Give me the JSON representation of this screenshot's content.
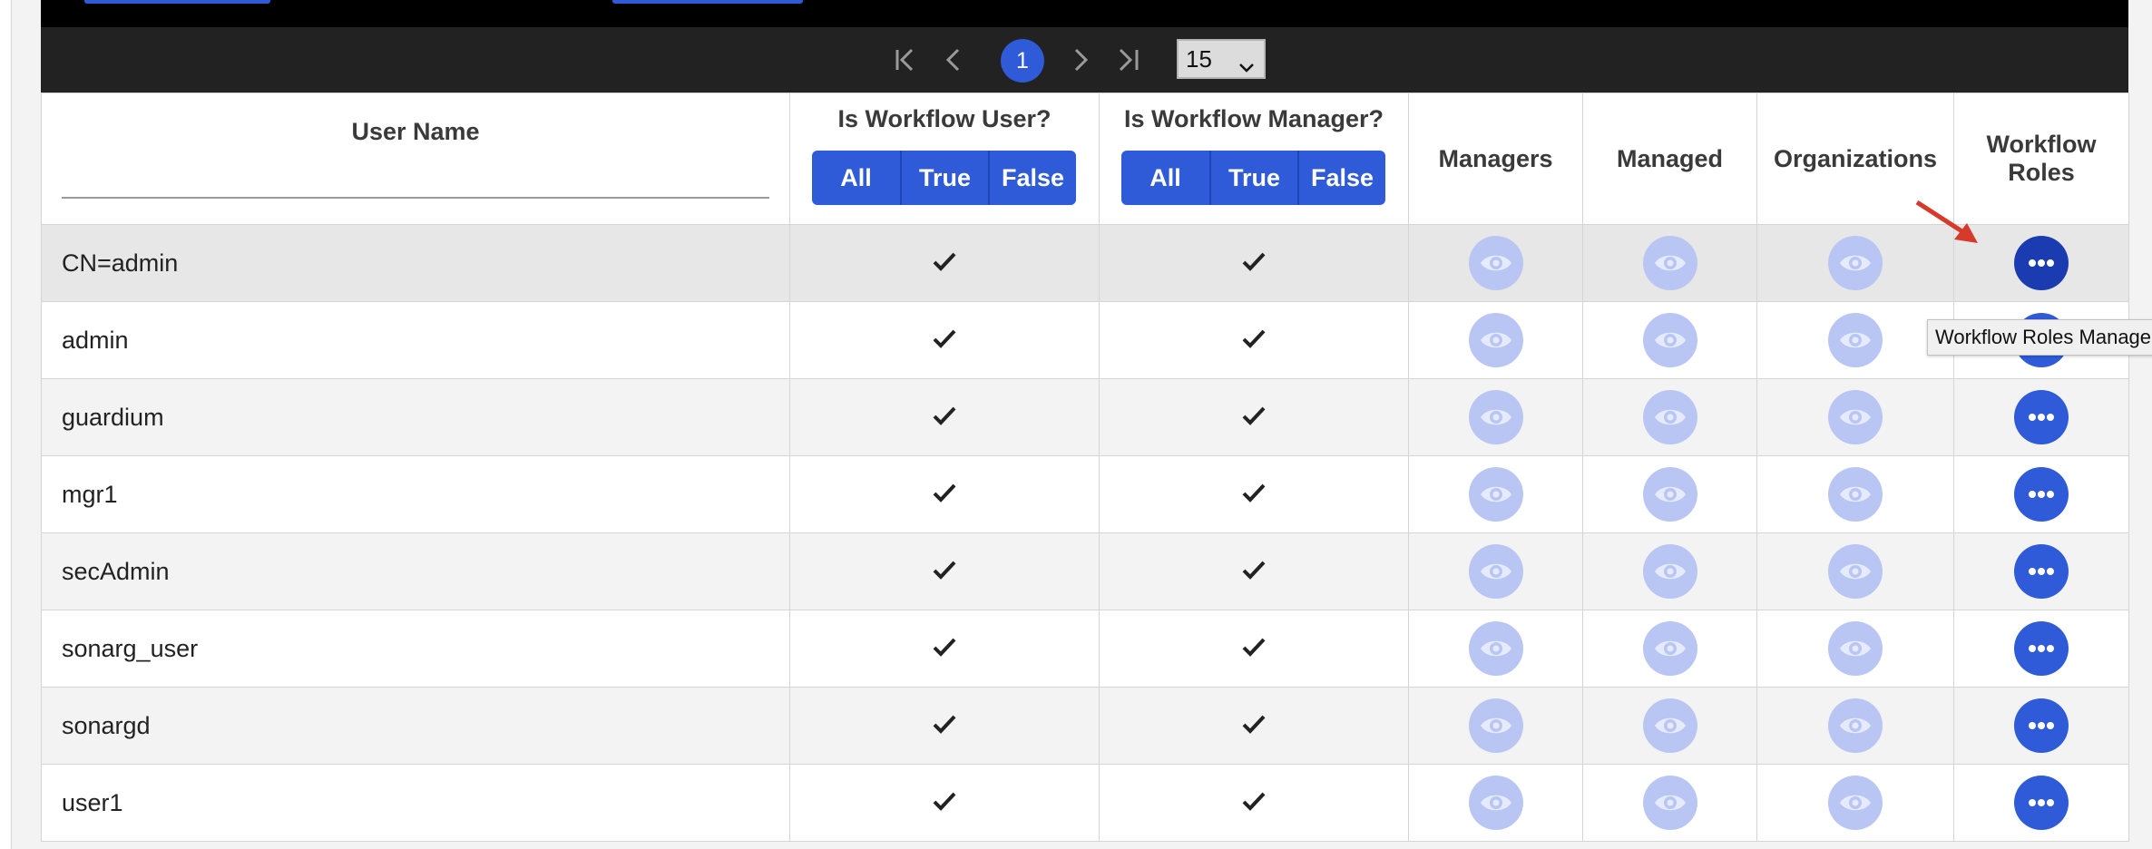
{
  "pagination": {
    "current_page": "1",
    "page_size": "15",
    "icons": [
      "first-page-icon",
      "prev-page-icon",
      "next-page-icon",
      "last-page-icon",
      "chevron-down-icon"
    ]
  },
  "table": {
    "headers": {
      "user_name": "User Name",
      "is_workflow_user": "Is Workflow User?",
      "is_workflow_manager": "Is Workflow Manager?",
      "managers": "Managers",
      "managed": "Managed",
      "organizations": "Organizations",
      "workflow_roles": "Workflow Roles"
    },
    "filter_options": [
      "All",
      "True",
      "False"
    ],
    "rows": [
      {
        "name": "CN=admin"
      },
      {
        "name": "admin"
      },
      {
        "name": "guardium"
      },
      {
        "name": "mgr1"
      },
      {
        "name": "secAdmin"
      },
      {
        "name": "sonarg_user"
      },
      {
        "name": "sonargd"
      },
      {
        "name": "user1"
      }
    ]
  },
  "tooltip": {
    "text": "Workflow Roles Manage"
  },
  "colors": {
    "accent": "#2f5ad8",
    "accent_active": "#1a3cb0",
    "eye_button": "#b9c6f4",
    "annotation_arrow": "#d63a2a"
  }
}
